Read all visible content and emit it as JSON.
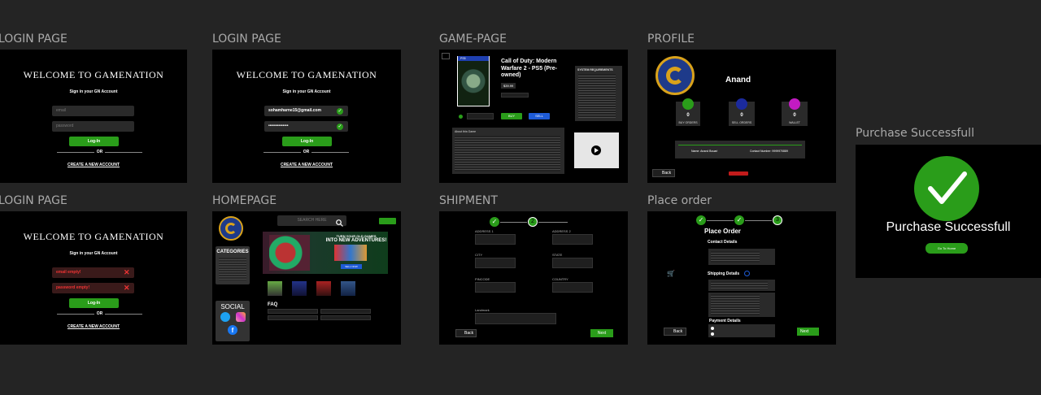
{
  "frames": {
    "login1": {
      "label": "LOGIN PAGE",
      "title": "WELCOME TO GAMENATION",
      "subtitle": "Sign in your GN Account",
      "email_ph": "email",
      "password_ph": "password",
      "login_btn": "Log-In",
      "or": "OR",
      "create": "CREATE A NEW ACCOUNT"
    },
    "login2": {
      "label": "LOGIN PAGE",
      "title": "WELCOME TO GAMENATION",
      "subtitle": "Sign in your GN Account",
      "email_val": "sohamharne15@gmail.com",
      "password_val": "••••••••••••••",
      "login_btn": "Log-In",
      "or": "OR",
      "create": "CREATE A NEW ACCOUNT"
    },
    "login3": {
      "label": "LOGIN PAGE",
      "title": "WELCOME TO GAMENATION",
      "subtitle": "Sign in your GN Account",
      "email_err": "email empty!",
      "password_err": "password empty!",
      "login_btn": "Log-In",
      "or": "OR",
      "create": "CREATE A NEW ACCOUNT"
    },
    "game": {
      "label": "GAME-PAGE",
      "platform": "PS5",
      "title": "Call of Duty: Modern Warfare 2 - PS5 (Pre-owned)",
      "price_tag": "$39.99",
      "buy": "BUY",
      "sell": "SELL",
      "sysreq": "SYSTEM REQUIREMENTS",
      "about": "About this Game"
    },
    "profile": {
      "label": "PROFILE",
      "name": "Anand",
      "stats": [
        {
          "value": "0",
          "label": "BUY ORDERS",
          "color": "#2a9d1a"
        },
        {
          "value": "0",
          "label": "SELL ORDERS",
          "color": "#1b2a9d"
        },
        {
          "value": "0",
          "label": "WALLET",
          "color": "#c21bc2"
        }
      ],
      "info_name": "Name: Anand Bouari",
      "info_contact": "Contact Number: 9999970889",
      "back": "Back"
    },
    "home": {
      "label": "HOMEPAGE",
      "search_ph": "SEARCH HERE",
      "categories": "CATEGORIES",
      "banner_line1": "TURN YOUR OLD GAMES",
      "banner_line2": "INTO NEW ADVENTURES!",
      "banner_btn": "SELL NOW",
      "social": "SOCIAL",
      "faq": "FAQ"
    },
    "shipment": {
      "label": "SHIPMENT",
      "steps": [
        "✓",
        "2"
      ],
      "fields": [
        "ADDRESS 1",
        "ADDRESS 2",
        "CITY",
        "STATE",
        "PINCODE",
        "COUNTRY",
        "Landmark"
      ],
      "back": "Back",
      "next": "Next"
    },
    "placeorder": {
      "label": "Place order",
      "steps": [
        "✓",
        "✓",
        "3"
      ],
      "title": "Place Order",
      "contact": "Contact Details",
      "shipping": "Shipping Details",
      "payment": "Payment Details",
      "back": "Back",
      "next": "Next"
    },
    "success": {
      "label": "Purchase Successfull",
      "message": "Purchase Successfull",
      "btn": "Go To Home"
    }
  },
  "colors": {
    "accent": "#2a9d1a",
    "bg": "#242424",
    "frame": "#000000",
    "error": "#e33333"
  }
}
